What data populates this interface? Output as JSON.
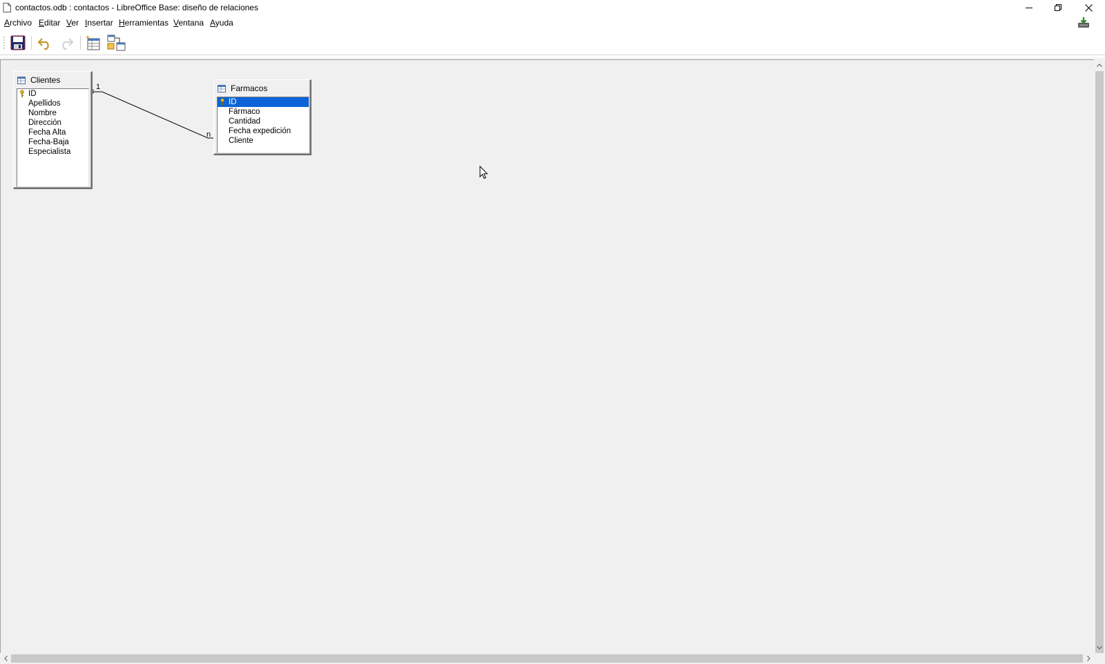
{
  "window": {
    "title": "contactos.odb : contactos - LibreOffice Base: diseño de relaciones"
  },
  "menu": {
    "items": [
      {
        "u": "A",
        "rest": "rchivo"
      },
      {
        "u": "E",
        "rest": "ditar"
      },
      {
        "u": "V",
        "rest": "er"
      },
      {
        "u": "I",
        "rest": "nsertar"
      },
      {
        "u": "H",
        "rest": "erramientas"
      },
      {
        "u": "V",
        "rest": "entana"
      },
      {
        "u": "A",
        "rest": "yuda"
      }
    ]
  },
  "toolbar": {
    "buttons": [
      "save-icon",
      "undo-icon",
      "redo-icon",
      "add-tables-icon",
      "new-relation-icon"
    ]
  },
  "tables": {
    "clientes": {
      "name": "Clientes",
      "fields": [
        "ID",
        "Apellidos",
        "Nombre",
        "Dirección",
        "Fecha Alta",
        "Fecha-Baja",
        "Especialista"
      ]
    },
    "farmacos": {
      "name": "Farmacos",
      "fields": [
        "ID",
        "Fármaco",
        "Cantidad",
        "Fecha expedición",
        "Cliente"
      ]
    }
  },
  "relation": {
    "from_label": "1",
    "to_label": "n"
  },
  "colors": {
    "selection": "#0a64d8",
    "canvas": "#f0f0f0"
  }
}
